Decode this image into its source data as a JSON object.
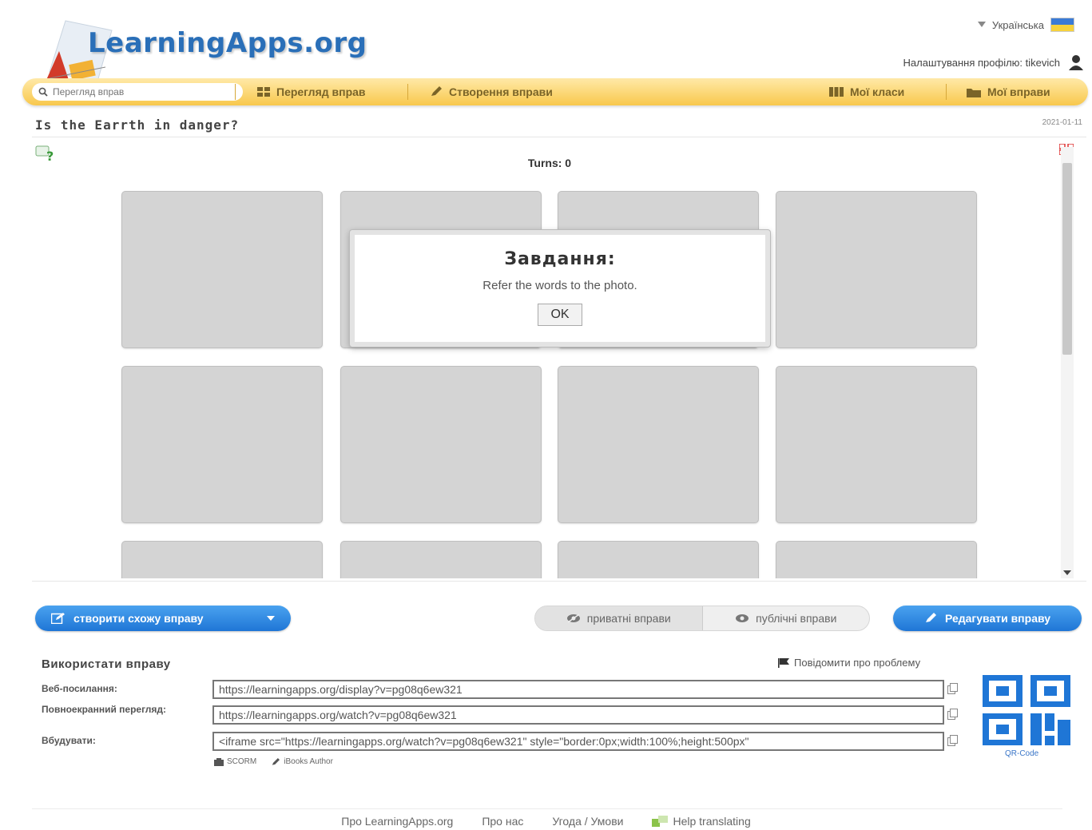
{
  "header": {
    "logo_text": "LearningApps.org",
    "language": "Українська",
    "profile_label": "Налаштування профілю: tikevich"
  },
  "nav": {
    "search_placeholder": "Перегляд вправ",
    "browse_label": "Перегляд вправ",
    "create_label": "Створення вправи",
    "classes_label": "Мої класи",
    "my_apps_label": "Мої вправи"
  },
  "page": {
    "title": "Is the Earrth in danger?",
    "date": "2021-01-11"
  },
  "app": {
    "turns_label": "Turns: 0",
    "dialog_title": "Завдання:",
    "dialog_text": "Refer the words to the photo.",
    "ok_label": "OK"
  },
  "actions": {
    "create_similar_label": "створити схожу вправу",
    "private_label": "приватні вправи",
    "public_label": "публічні вправи",
    "edit_label": "Редагувати вправу"
  },
  "use": {
    "title": "Використати вправу",
    "report_label": "Повідомити про проблему",
    "web_label": "Веб-посилання:",
    "web_url": "https://learningapps.org/display?v=pg08q6ew321",
    "fullscreen_label": "Повноекранний перегляд:",
    "fullscreen_url": "https://learningapps.org/watch?v=pg08q6ew321",
    "embed_label": "Вбудувати:",
    "embed_code": "<iframe src=\"https://learningapps.org/watch?v=pg08q6ew321\" style=\"border:0px;width:100%;height:500px\"",
    "scorm_label": "SCORM",
    "ibooks_label": "iBooks Author",
    "qr_label": "QR-Code"
  },
  "footer": {
    "about": "Про LearningApps.org",
    "about_us": "Про нас",
    "terms": "Угода / Умови",
    "help_translating": "Help translating"
  },
  "colors": {
    "accent_blue": "#1f76d6",
    "nav_yellow": "#f8c84c",
    "card_grey": "#d4d4d4"
  }
}
